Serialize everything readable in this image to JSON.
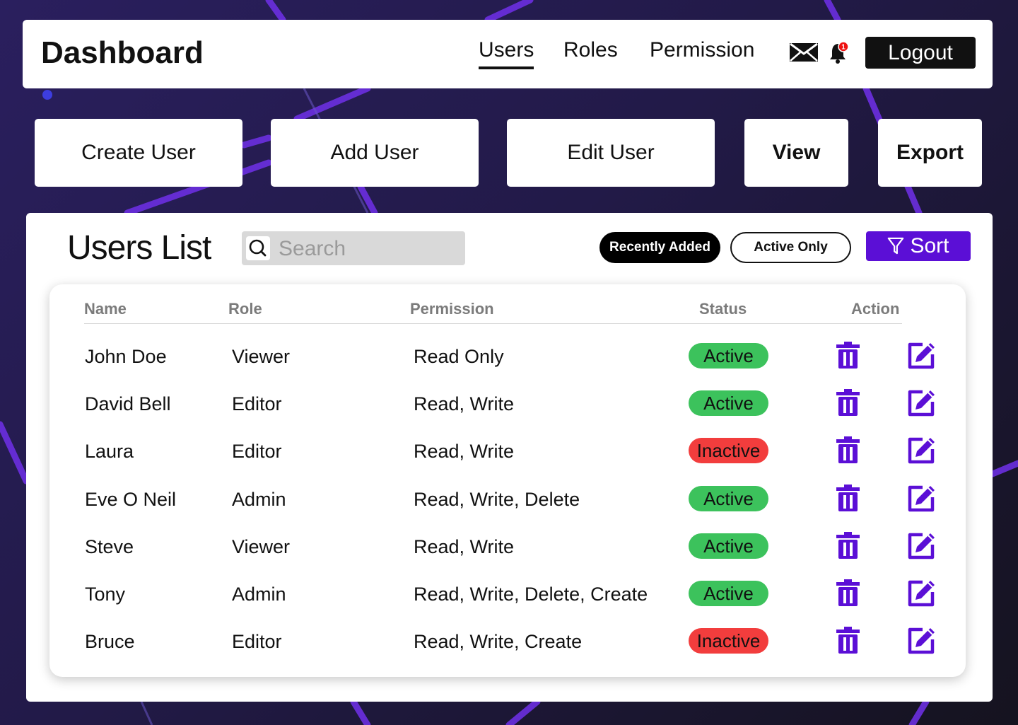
{
  "header": {
    "title": "Dashboard",
    "nav": [
      "Users",
      "Roles",
      "Permission"
    ],
    "active_nav": "Users",
    "mail_icon": "mail-icon",
    "bell_icon": "bell-icon",
    "notification_count": "1",
    "logout_label": "Logout"
  },
  "actions": {
    "create": "Create User",
    "add": "Add User",
    "edit": "Edit User",
    "view": "View",
    "export": "Export"
  },
  "users_list": {
    "title": "Users List",
    "search_placeholder": "Search",
    "filters": {
      "recent": "Recently Added",
      "active_only": "Active Only"
    },
    "sort_label": "Sort",
    "columns": {
      "name": "Name",
      "role": "Role",
      "permission": "Permission",
      "status": "Status",
      "action": "Action"
    },
    "rows": [
      {
        "name": "John Doe",
        "role": "Viewer",
        "permission": "Read Only",
        "status": "Active"
      },
      {
        "name": "David Bell",
        "role": "Editor",
        "permission": "Read, Write",
        "status": "Active"
      },
      {
        "name": "Laura",
        "role": "Editor",
        "permission": "Read, Write",
        "status": "Inactive"
      },
      {
        "name": "Eve O Neil",
        "role": "Admin",
        "permission": "Read, Write, Delete",
        "status": "Active"
      },
      {
        "name": "Steve",
        "role": "Viewer",
        "permission": "Read, Write",
        "status": "Active"
      },
      {
        "name": "Tony",
        "role": "Admin",
        "permission": "Read, Write, Delete, Create",
        "status": "Active"
      },
      {
        "name": "Bruce",
        "role": "Editor",
        "permission": "Read, Write, Create",
        "status": "Inactive"
      }
    ]
  },
  "colors": {
    "accent": "#5b0fd6",
    "active": "#3cc25c",
    "inactive": "#f23d3d",
    "icon": "#5b0fd6"
  }
}
